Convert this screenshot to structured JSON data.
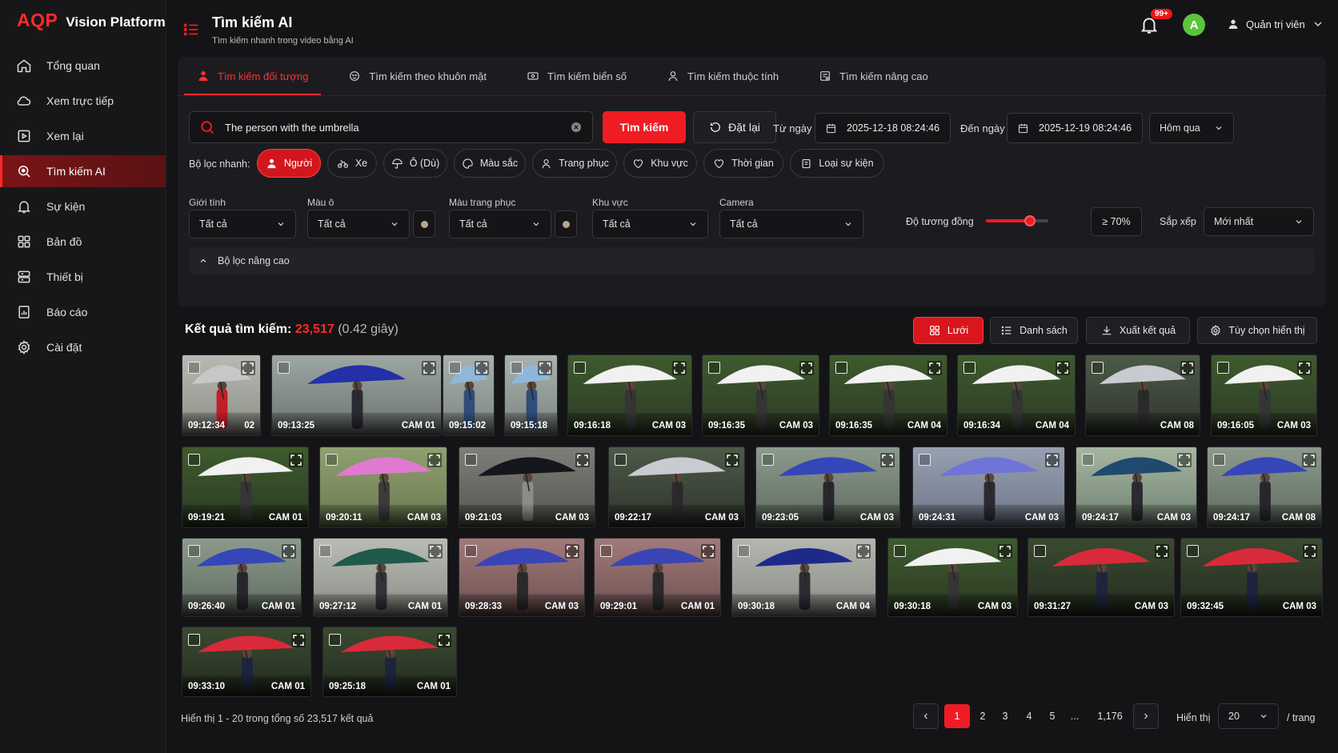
{
  "brand": {
    "logo": "AQP",
    "name": "Vision Platform"
  },
  "sidebar": {
    "items": [
      {
        "label": "Tổng quan",
        "icon": "home-icon",
        "active": false
      },
      {
        "label": "Xem trực tiếp",
        "icon": "cloud-icon",
        "active": false
      },
      {
        "label": "Xem lại",
        "icon": "playback-icon",
        "active": false
      },
      {
        "label": "Tìm kiếm AI",
        "icon": "search-icon",
        "active": true
      },
      {
        "label": "Sự kiện",
        "icon": "bell-icon",
        "active": false
      },
      {
        "label": "Bản đồ",
        "icon": "map-grid-icon",
        "active": false
      },
      {
        "label": "Thiết bị",
        "icon": "device-icon",
        "active": false
      },
      {
        "label": "Báo cáo",
        "icon": "report-icon",
        "active": false
      },
      {
        "label": "Cài đặt",
        "icon": "gear-icon",
        "active": false
      }
    ]
  },
  "header": {
    "title": "Tìm kiếm AI",
    "subtitle": "Tìm kiếm nhanh trong video bằng AI",
    "notifications": "99+",
    "avatar_letter": "A",
    "user_name": "Quản trị viên"
  },
  "tabs": [
    {
      "label": "Tìm kiếm đối tượng",
      "icon": "person-icon",
      "active": true
    },
    {
      "label": "Tìm kiếm theo khuôn mặt",
      "icon": "face-icon",
      "active": false
    },
    {
      "label": "Tìm kiếm biển số",
      "icon": "plate-icon",
      "active": false
    },
    {
      "label": "Tìm kiếm thuộc tính",
      "icon": "attribute-icon",
      "active": false
    },
    {
      "label": "Tìm kiếm nâng cao",
      "icon": "advanced-icon",
      "active": false
    }
  ],
  "search": {
    "value": "The person with the umbrella",
    "search_label": "Tìm kiếm",
    "reset_label": "Đặt lại",
    "from_label": "Từ ngày",
    "from_value": "2025-12-18 08:24:46",
    "to_label": "Đến ngày",
    "to_value": "2025-12-19 08:24:46",
    "range_value": "Hôm qua"
  },
  "quick_filters": {
    "label": "Bộ lọc nhanh:",
    "chips": [
      {
        "label": "Người",
        "icon": "person-icon",
        "active": true
      },
      {
        "label": "Xe",
        "icon": "bike-icon",
        "active": false
      },
      {
        "label": "Ô (Dù)",
        "icon": "umbrella-icon",
        "active": false
      },
      {
        "label": "Màu sắc",
        "icon": "palette-icon",
        "active": false
      },
      {
        "label": "Trang phục",
        "icon": "clothes-icon",
        "active": false
      },
      {
        "label": "Khu vực",
        "icon": "area-icon",
        "active": false
      },
      {
        "label": "Thời gian",
        "icon": "time-icon",
        "active": false
      },
      {
        "label": "Loại sự kiện",
        "icon": "event-type-icon",
        "active": false
      }
    ]
  },
  "filters": {
    "gender": {
      "label": "Giới tính",
      "value": "Tất cả"
    },
    "umbrella_color": {
      "label": "Màu ô",
      "value": "Tất cả"
    },
    "clothes_color": {
      "label": "Màu trang phục",
      "value": "Tất cả"
    },
    "area": {
      "label": "Khu vực",
      "value": "Tất cả"
    },
    "camera": {
      "label": "Camera",
      "value": "Tất cả"
    },
    "similarity_label": "Độ tương đồng",
    "similarity_value": "≥ 70%",
    "similarity_fraction": 0.7,
    "sort_label": "Sắp xếp",
    "sort_value": "Mới nhất",
    "advanced_label": "Bộ lọc nâng cao"
  },
  "results": {
    "title": "Kết quả tìm kiếm:",
    "count": "23,517",
    "time": "(0.42 giây)",
    "grid_label": "Lưới",
    "list_label": "Danh sách",
    "export_label": "Xuất kết quả",
    "display_options_label": "Tùy chọn hiển thị",
    "items": [
      {
        "time": "09:12:34",
        "cam": "02",
        "scene": "red-jacket-clear"
      },
      {
        "time": "09:13:25",
        "cam": "CAM 01",
        "scene": "blue-umbrella-street"
      },
      {
        "time": "09:15:02",
        "cam": "",
        "scene": "small-print"
      },
      {
        "time": "09:15:18",
        "cam": "",
        "scene": "small-print"
      },
      {
        "time": "09:16:18",
        "cam": "CAM 03",
        "scene": "white-umbrella-trees"
      },
      {
        "time": "09:16:35",
        "cam": "CAM 03",
        "scene": "white-umbrella-trees"
      },
      {
        "time": "09:16:35",
        "cam": "CAM 04",
        "scene": "white-umbrella-trees"
      },
      {
        "time": "09:16:34",
        "cam": "CAM 04",
        "scene": "white-umbrella-trees"
      },
      {
        "time": "",
        "cam": "CAM 08",
        "scene": "silver-umbrella"
      },
      {
        "time": "09:16:05",
        "cam": "CAM 03",
        "scene": "white-umbrella-trees"
      },
      {
        "time": "09:19:21",
        "cam": "CAM 01",
        "scene": "white-umbrella-trees"
      },
      {
        "time": "09:20:11",
        "cam": "CAM 03",
        "scene": "pink-umbrella"
      },
      {
        "time": "09:21:03",
        "cam": "CAM 03",
        "scene": "black-umbrella"
      },
      {
        "time": "09:22:17",
        "cam": "CAM 03",
        "scene": "silver-umbrella"
      },
      {
        "time": "09:23:05",
        "cam": "CAM 03",
        "scene": "blue-print-street"
      },
      {
        "time": "09:24:31",
        "cam": "CAM 03",
        "scene": "lavender-umbrella"
      },
      {
        "time": "09:24:17",
        "cam": "CAM 03",
        "scene": "teal-print"
      },
      {
        "time": "09:24:17",
        "cam": "CAM 08",
        "scene": "blue-print-street"
      },
      {
        "time": "09:26:40",
        "cam": "CAM 01",
        "scene": "blue-print-street"
      },
      {
        "time": "09:27:12",
        "cam": "CAM 01",
        "scene": "green-umbrella"
      },
      {
        "time": "09:28:33",
        "cam": "CAM 03",
        "scene": "blue-print-fence"
      },
      {
        "time": "09:29:01",
        "cam": "CAM 01",
        "scene": "blue-print-fence"
      },
      {
        "time": "09:30:18",
        "cam": "CAM 04",
        "scene": "navy-umbrella"
      },
      {
        "time": "09:30:18",
        "cam": "CAM 03",
        "scene": "white-umbrella-trees"
      },
      {
        "time": "09:31:27",
        "cam": "CAM 03",
        "scene": "red-umbrella"
      },
      {
        "time": "09:32:45",
        "cam": "CAM 03",
        "scene": "red-umbrella"
      },
      {
        "time": "09:33:10",
        "cam": "CAM 01",
        "scene": "red-umbrella"
      },
      {
        "time": "09:25:18",
        "cam": "CAM 01",
        "scene": "red-umbrella"
      }
    ]
  },
  "pagination": {
    "info": "Hiển thị 1 - 20 trong tổng số 23,517 kết quả",
    "pages": [
      "1",
      "2",
      "3",
      "4",
      "5",
      "...",
      "1,176"
    ],
    "current": "1",
    "show_label": "Hiển thị",
    "page_size": "20",
    "per_page_label": "/ trang"
  },
  "colors": {
    "accent": "#ef1c24",
    "bg": "#141417",
    "panel": "#1c1c20"
  }
}
